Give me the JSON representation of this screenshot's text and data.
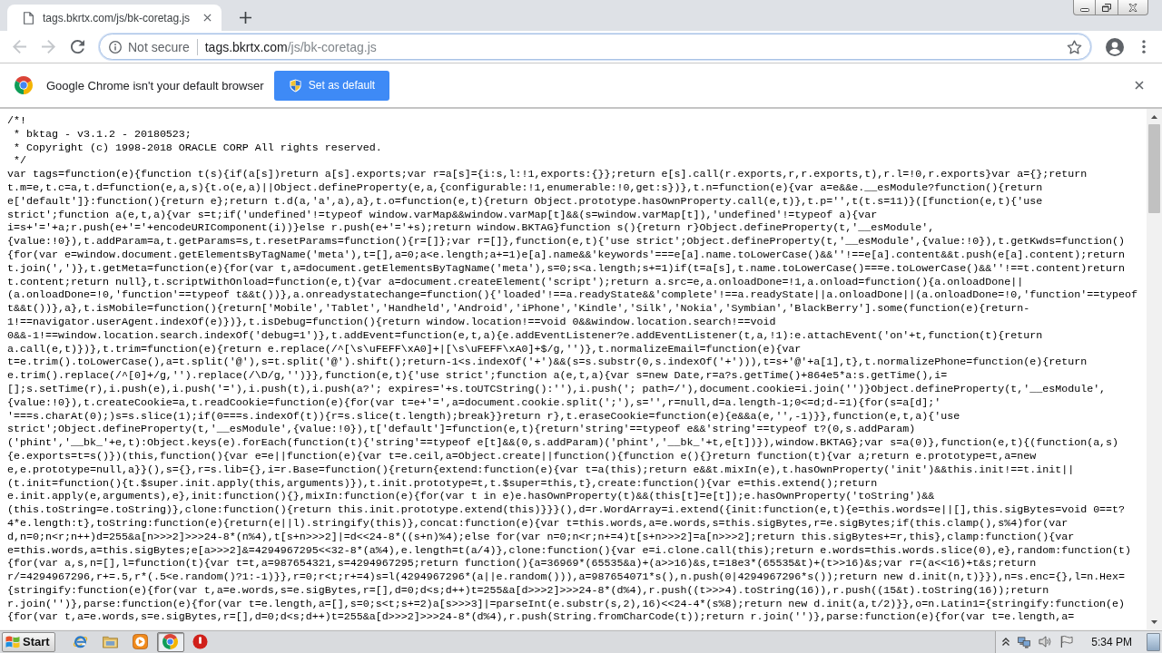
{
  "tabs": [
    {
      "title": "tags.bkrtx.com/js/bk-coretag.js",
      "selected": true
    }
  ],
  "toolbar": {
    "nav_buttons": [
      {
        "kind": "back",
        "disabled": true
      },
      {
        "kind": "forward",
        "disabled": true
      },
      {
        "kind": "reload",
        "disabled": false
      }
    ],
    "address_bar": {
      "security_label": "Not secure",
      "url_host": "tags.bkrtx.com",
      "url_path": "/js/bk-coretag.js"
    }
  },
  "infobar": {
    "message": "Google Chrome isn't your default browser",
    "button": "Set as default"
  },
  "code_lines": [
    "/*!",
    " * bktag - v3.1.2 - 20180523;",
    " * Copyright (c) 1998-2018 ORACLE CORP All rights reserved.",
    " */",
    "var tags=function(e){function t(s){if(a[s])return a[s].exports;var r=a[s]={i:s,l:!1,exports:{}};return e[s].call(r.exports,r,r.exports,t),r.l=!0,r.exports}var a={};return",
    "t.m=e,t.c=a,t.d=function(e,a,s){t.o(e,a)||Object.defineProperty(e,a,{configurable:!1,enumerable:!0,get:s})},t.n=function(e){var a=e&&e.__esModule?function(){return",
    "e['default']}:function(){return e};return t.d(a,'a',a),a},t.o=function(e,t){return Object.prototype.hasOwnProperty.call(e,t)},t.p='',t(t.s=11)}([function(e,t){'use",
    "strict';function a(e,t,a){var s=t;if('undefined'!=typeof window.varMap&&window.varMap[t]&&(s=window.varMap[t]),'undefined'!=typeof a){var",
    "i=s+'='+a;r.push(e+'='+encodeURIComponent(i))}else r.push(e+'='+s);return window.BKTAG}function s(){return r}Object.defineProperty(t,'__esModule',",
    "{value:!0}),t.addParam=a,t.getParams=s,t.resetParams=function(){r=[]};var r=[]},function(e,t){'use strict';Object.defineProperty(t,'__esModule',{value:!0}),t.getKwds=function()",
    "{for(var e=window.document.getElementsByTagName('meta'),t=[],a=0;a<e.length;a+=1)e[a].name&&'keywords'===e[a].name.toLowerCase()&&''!==e[a].content&&t.push(e[a].content);return",
    "t.join(',')},t.getMeta=function(e){for(var t,a=document.getElementsByTagName('meta'),s=0;s<a.length;s+=1)if(t=a[s],t.name.toLowerCase()===e.toLowerCase()&&''!==t.content)return",
    "t.content;return null},t.scriptWithOnload=function(e,t){var a=document.createElement('script');return a.src=e,a.onloadDone=!1,a.onload=function(){a.onloadDone||",
    "(a.onloadDone=!0,'function'==typeof t&&t())},a.onreadystatechange=function(){'loaded'!==a.readyState&&'complete'!==a.readyState||a.onloadDone||(a.onloadDone=!0,'function'==typeof",
    "t&&t())},a},t.isMobile=function(){return['Mobile','Tablet','Handheld','Android','iPhone','Kindle','Silk','Nokia','Symbian','BlackBerry'].some(function(e){return-",
    "1!==navigator.userAgent.indexOf(e)})},t.isDebug=function(){return window.location!==void 0&&window.location.search!==void",
    "0&&-1!==window.location.search.indexOf('debug=1')},t.addEvent=function(e,t,a){e.addEventListener?e.addEventListener(t,a,!1):e.attachEvent('on'+t,function(t){return",
    "a.call(e,t)})},t.trim=function(e){return e.replace(/^[\\s\\uFEFF\\xA0]+|[\\s\\uFEFF\\xA0]+$/g,'')},t.normalizeEmail=function(e){var",
    "t=e.trim().toLowerCase(),a=t.split('@'),s=t.split('@').shift();return-1<s.indexOf('+')&&(s=s.substr(0,s.indexOf('+'))),t=s+'@'+a[1],t},t.normalizePhone=function(e){return",
    "e.trim().replace(/^[0]+/g,'').replace(/\\D/g,'')}},function(e,t){'use strict';function a(e,t,a){var s=new Date,r=a?s.getTime()+864e5*a:s.getTime(),i=",
    "[];s.setTime(r),i.push(e),i.push('='),i.push(t),i.push(a?'; expires='+s.toUTCString():''),i.push('; path=/'),document.cookie=i.join('')}Object.defineProperty(t,'__esModule',",
    "{value:!0}),t.createCookie=a,t.readCookie=function(e){for(var t=e+'=',a=document.cookie.split(';'),s='',r=null,d=a.length-1;0<=d;d-=1){for(s=a[d];'",
    "'===s.charAt(0);)s=s.slice(1);if(0===s.indexOf(t)){r=s.slice(t.length);break}}return r},t.eraseCookie=function(e){e&&a(e,'',-1)}},function(e,t,a){'use",
    "strict';Object.defineProperty(t,'__esModule',{value:!0}),t['default']=function(e,t){return'string'==typeof e&&'string'==typeof t?(0,s.addParam)",
    "('phint','__bk_'+e,t):Object.keys(e).forEach(function(t){'string'==typeof e[t]&&(0,s.addParam)('phint','__bk_'+t,e[t])}),window.BKTAG};var s=a(0)},function(e,t){(function(a,s)",
    "{e.exports=t=s()})(this,function(){var e=e||function(e){var t=e.ceil,a=Object.create||function(){function e(){}return function(t){var a;return e.prototype=t,a=new",
    "e,e.prototype=null,a}}(),s={},r=s.lib={},i=r.Base=function(){return{extend:function(e){var t=a(this);return e&&t.mixIn(e),t.hasOwnProperty('init')&&this.init!==t.init||",
    "(t.init=function(){t.$super.init.apply(this,arguments)}),t.init.prototype=t,t.$super=this,t},create:function(){var e=this.extend();return",
    "e.init.apply(e,arguments),e},init:function(){},mixIn:function(e){for(var t in e)e.hasOwnProperty(t)&&(this[t]=e[t]);e.hasOwnProperty('toString')&&",
    "(this.toString=e.toString)},clone:function(){return this.init.prototype.extend(this)}}}(),d=r.WordArray=i.extend({init:function(e,t){e=this.words=e||[],this.sigBytes=void 0==t?",
    "4*e.length:t},toString:function(e){return(e||l).stringify(this)},concat:function(e){var t=this.words,a=e.words,s=this.sigBytes,r=e.sigBytes;if(this.clamp(),s%4)for(var",
    "d,n=0;n<r;n++)d=255&a[n>>>2]>>>24-8*(n%4),t[s+n>>>2]|=d<<24-8*((s+n)%4);else for(var n=0;n<r;n+=4)t[s+n>>>2]=a[n>>>2];return this.sigBytes+=r,this},clamp:function(){var",
    "e=this.words,a=this.sigBytes;e[a>>>2]&=4294967295<<32-8*(a%4),e.length=t(a/4)},clone:function(){var e=i.clone.call(this);return e.words=this.words.slice(0),e},random:function(t)",
    "{for(var a,s,n=[],l=function(t){var t=t,a=987654321,s=4294967295;return function(){a=36969*(65535&a)+(a>>16)&s,t=18e3*(65535&t)+(t>>16)&s;var r=(a<<16)+t&s;return",
    "r/=4294967296,r+=.5,r*(.5<e.random()?1:-1)}},r=0;r<t;r+=4)s=l(4294967296*(a||e.random())),a=987654071*s(),n.push(0|4294967296*s());return new d.init(n,t)}}),n=s.enc={},l=n.Hex=",
    "{stringify:function(e){for(var t,a=e.words,s=e.sigBytes,r=[],d=0;d<s;d++)t=255&a[d>>>2]>>>24-8*(d%4),r.push((t>>>4).toString(16)),r.push((15&t).toString(16));return",
    "r.join('')},parse:function(e){for(var t=e.length,a=[],s=0;s<t;s+=2)a[s>>>3]|=parseInt(e.substr(s,2),16)<<24-4*(s%8);return new d.init(a,t/2)}},o=n.Latin1={stringify:function(e)",
    "{for(var t,a=e.words,s=e.sigBytes,r=[],d=0;d<s;d++)t=255&a[d>>>2]>>>24-8*(d%4),r.push(String.fromCharCode(t));return r.join('')},parse:function(e){for(var t=e.length,a="
  ],
  "taskbar": {
    "start_label": "Start",
    "apps": [
      {
        "kind": "browser-e",
        "selected": false
      },
      {
        "kind": "folder",
        "selected": false
      },
      {
        "kind": "media-player",
        "selected": false
      },
      {
        "kind": "chrome",
        "selected": true
      },
      {
        "kind": "stop",
        "selected": false
      }
    ],
    "clock": "5:34 PM"
  }
}
